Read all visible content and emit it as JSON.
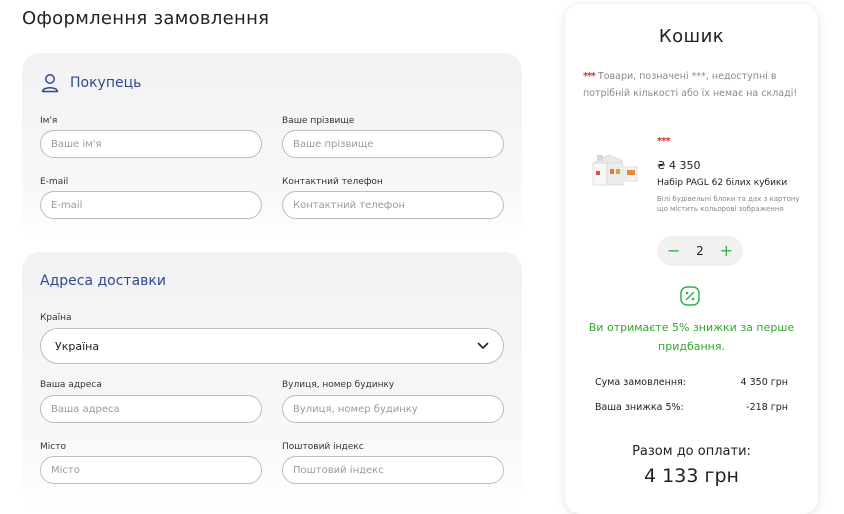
{
  "page": {
    "title": "Оформлення замовлення"
  },
  "buyer": {
    "title": "Покупець",
    "first_name": {
      "label": "Ім'я",
      "placeholder": "Ваше ім'я"
    },
    "last_name": {
      "label": "Ваше прізвище",
      "placeholder": "Ваше прізвище"
    },
    "email": {
      "label": "E-mail",
      "placeholder": "E-mail"
    },
    "phone": {
      "label": "Контактний телефон",
      "placeholder": "Контактний телефон"
    }
  },
  "address": {
    "title": "Адреса доставки",
    "country": {
      "label": "Країна",
      "value": "Україна"
    },
    "your_address": {
      "label": "Ваша адреса",
      "placeholder": "Ваша адреса"
    },
    "street": {
      "label": "Вулиця, номер будинку",
      "placeholder": "Вулиця, номер будинку"
    },
    "city": {
      "label": "Місто",
      "placeholder": "Місто"
    },
    "postal": {
      "label": "Поштовий індекс",
      "placeholder": "Поштовий індекс"
    }
  },
  "cart": {
    "title": "Кошик",
    "notice_stars": "***",
    "notice_text": " Товари, позначені ***, недоступні в потрібній кількості або їх немає на складі!",
    "product": {
      "stars": "***",
      "price": "₴ 4 350",
      "name": "Набір PAGL 62 білих кубики",
      "description": "Білі будівельні блоки та дах з картону що містить кольорові зображення",
      "quantity": "2",
      "minus": "−",
      "plus": "+"
    },
    "discount_text": "Ви отримаєте 5% знижки за перше придбання.",
    "order_sum": {
      "label": "Сума замовлення:",
      "value": "4 350 грн"
    },
    "discount": {
      "label": "Ваша знижка 5%:",
      "value": "-218 грн"
    },
    "total": {
      "label": "Разом до оплати:",
      "value": "4 133 грн"
    }
  },
  "colors": {
    "accent_blue": "#2f4a8a",
    "green": "#2bb24c",
    "red_stars": "#d9342b"
  }
}
